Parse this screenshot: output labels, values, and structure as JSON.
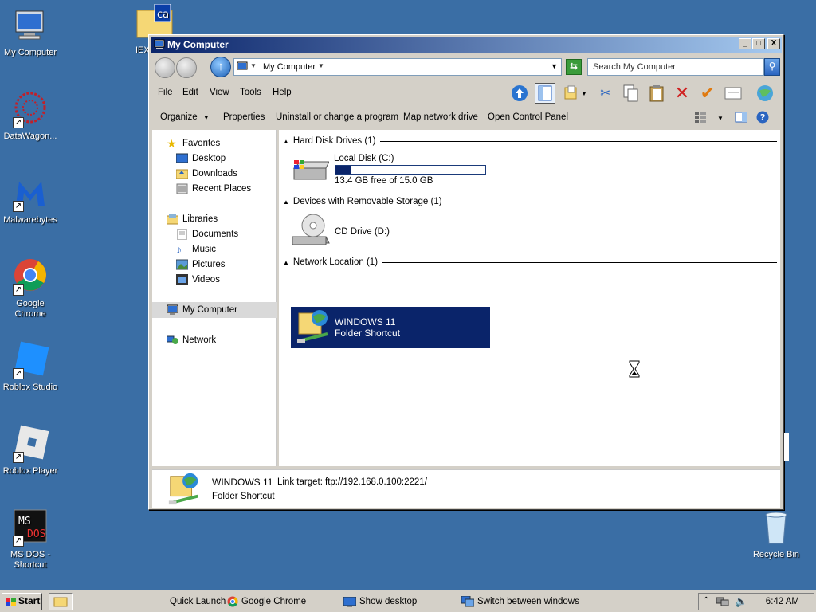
{
  "desktop": {
    "icons": [
      {
        "label": "My Computer"
      },
      {
        "label": "DataWagon..."
      },
      {
        "label": "Malwarebytes"
      },
      {
        "label": "Google Chrome"
      },
      {
        "label": "Roblox Studio"
      },
      {
        "label": "Roblox Player"
      },
      {
        "label": "MS DOS - Shortcut"
      },
      {
        "label": "Recycle Bin"
      }
    ],
    "partial_icon_label": "IEX"
  },
  "window": {
    "title": "My Computer",
    "minimize": "_",
    "maximize": "□",
    "close": "X",
    "address_value": "My Computer",
    "search_placeholder": "Search My Computer",
    "menu": [
      "File",
      "Edit",
      "View",
      "Tools",
      "Help"
    ],
    "commands": [
      "Organize",
      "Properties",
      "Uninstall or change a program",
      "Map network drive",
      "Open Control Panel"
    ]
  },
  "navigation": {
    "favorites_header": "Favorites",
    "favorites": [
      "Desktop",
      "Downloads",
      "Recent Places"
    ],
    "libraries_header": "Libraries",
    "libraries": [
      "Documents",
      "Music",
      "Pictures",
      "Videos"
    ],
    "computer": "My Computer",
    "network": "Network"
  },
  "content": {
    "groups": [
      {
        "label": "Hard Disk Drives (1)"
      },
      {
        "label": "Devices with Removable Storage (1)"
      },
      {
        "label": "Network Location (1)"
      }
    ],
    "local_disk": {
      "name": "Local Disk (C:)",
      "free": "13.4 GB free of 15.0 GB",
      "used_fraction": 0.107
    },
    "cd_drive": {
      "name": "CD Drive (D:)"
    },
    "network_item": {
      "name": "WINDOWS 11",
      "type": "Folder Shortcut"
    }
  },
  "details": {
    "name": "WINDOWS 11",
    "link_target_label": "Link target:",
    "link_target": "ftp://192.168.0.100:2221/",
    "type": "Folder Shortcut"
  },
  "taskbar": {
    "start": "Start",
    "quick_launch": "Quick Launch",
    "chrome": "Google Chrome",
    "show_desktop": "Show desktop",
    "switch_windows": "Switch between windows",
    "clock": "6:42 AM"
  },
  "colors": {
    "desktop": "#3a6ea5",
    "title_active": "#0a246a",
    "selection": "#0a246a"
  }
}
